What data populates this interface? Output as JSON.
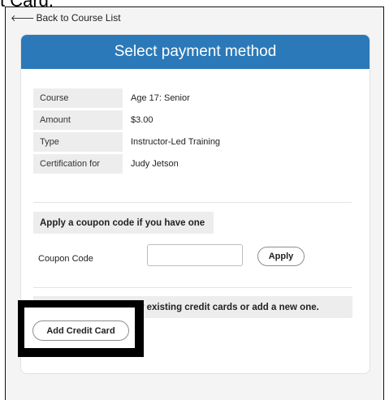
{
  "top_crop_text": "t Card.",
  "nav": {
    "back_label": "Back to Course List"
  },
  "header": {
    "title": "Select payment method"
  },
  "details": [
    {
      "key": "Course",
      "value": "Age 17: Senior"
    },
    {
      "key": "Amount",
      "value": "$3.00"
    },
    {
      "key": "Type",
      "value": "Instructor-Led Training"
    },
    {
      "key": "Certification for",
      "value": "Judy Jetson"
    }
  ],
  "coupon": {
    "section_label": "Apply a coupon code if you have one",
    "field_label": "Coupon Code",
    "value": "",
    "apply_label": "Apply"
  },
  "credit": {
    "section_label": "Select from one of your existing credit cards or add a new one.",
    "add_label": "Add Credit Card"
  },
  "colors": {
    "header_bg": "#2b79b8",
    "frame_bg": "#f4f4f4"
  }
}
